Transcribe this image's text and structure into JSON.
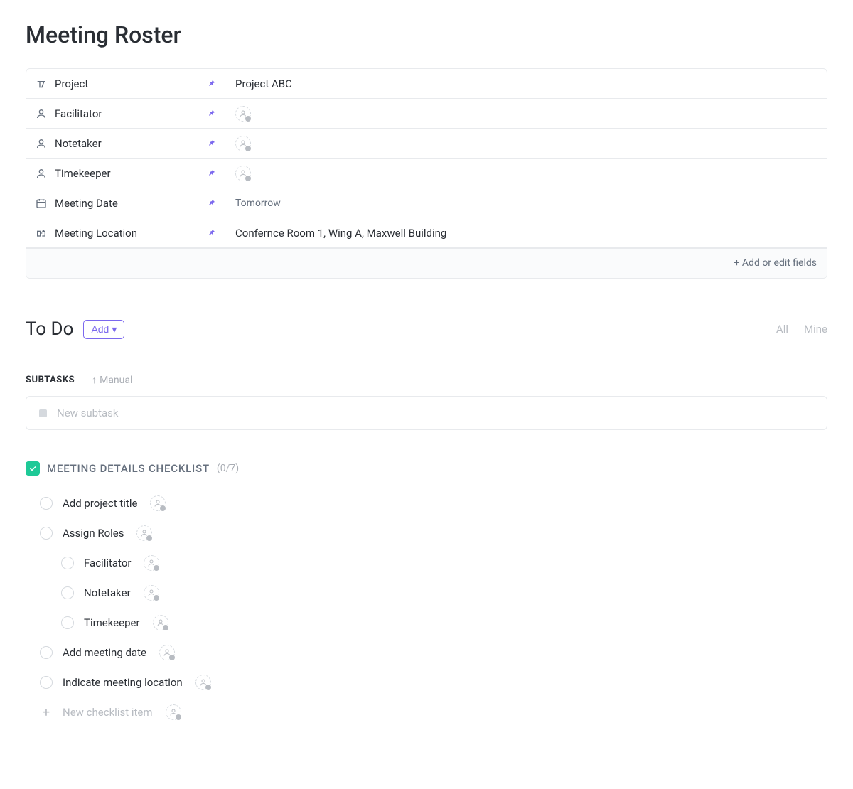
{
  "page": {
    "title": "Meeting Roster"
  },
  "fields": [
    {
      "icon": "text",
      "label": "Project",
      "value": "Project ABC",
      "type": "text"
    },
    {
      "icon": "person",
      "label": "Facilitator",
      "value": "",
      "type": "person"
    },
    {
      "icon": "person",
      "label": "Notetaker",
      "value": "",
      "type": "person"
    },
    {
      "icon": "person",
      "label": "Timekeeper",
      "value": "",
      "type": "person"
    },
    {
      "icon": "calendar",
      "label": "Meeting Date",
      "value": "Tomorrow",
      "type": "date"
    },
    {
      "icon": "location",
      "label": "Meeting Location",
      "value": "Confernce Room 1, Wing A, Maxwell Building",
      "type": "text"
    }
  ],
  "fields_footer": {
    "add_edit_label": "+ Add or edit fields"
  },
  "todo": {
    "title": "To Do",
    "add_label": "Add",
    "tabs": {
      "all": "All",
      "mine": "Mine"
    },
    "subtasks_label": "SUBTASKS",
    "sort_mode": "Manual",
    "new_subtask_placeholder": "New subtask"
  },
  "checklist": {
    "title": "MEETING DETAILS CHECKLIST",
    "count": "(0/7)",
    "new_item_label": "New checklist item",
    "items": [
      {
        "label": "Add project title",
        "nested": false
      },
      {
        "label": "Assign Roles",
        "nested": false
      },
      {
        "label": "Facilitator",
        "nested": true
      },
      {
        "label": "Notetaker",
        "nested": true
      },
      {
        "label": "Timekeeper",
        "nested": true
      },
      {
        "label": "Add meeting date",
        "nested": false
      },
      {
        "label": "Indicate meeting location",
        "nested": false
      }
    ]
  }
}
